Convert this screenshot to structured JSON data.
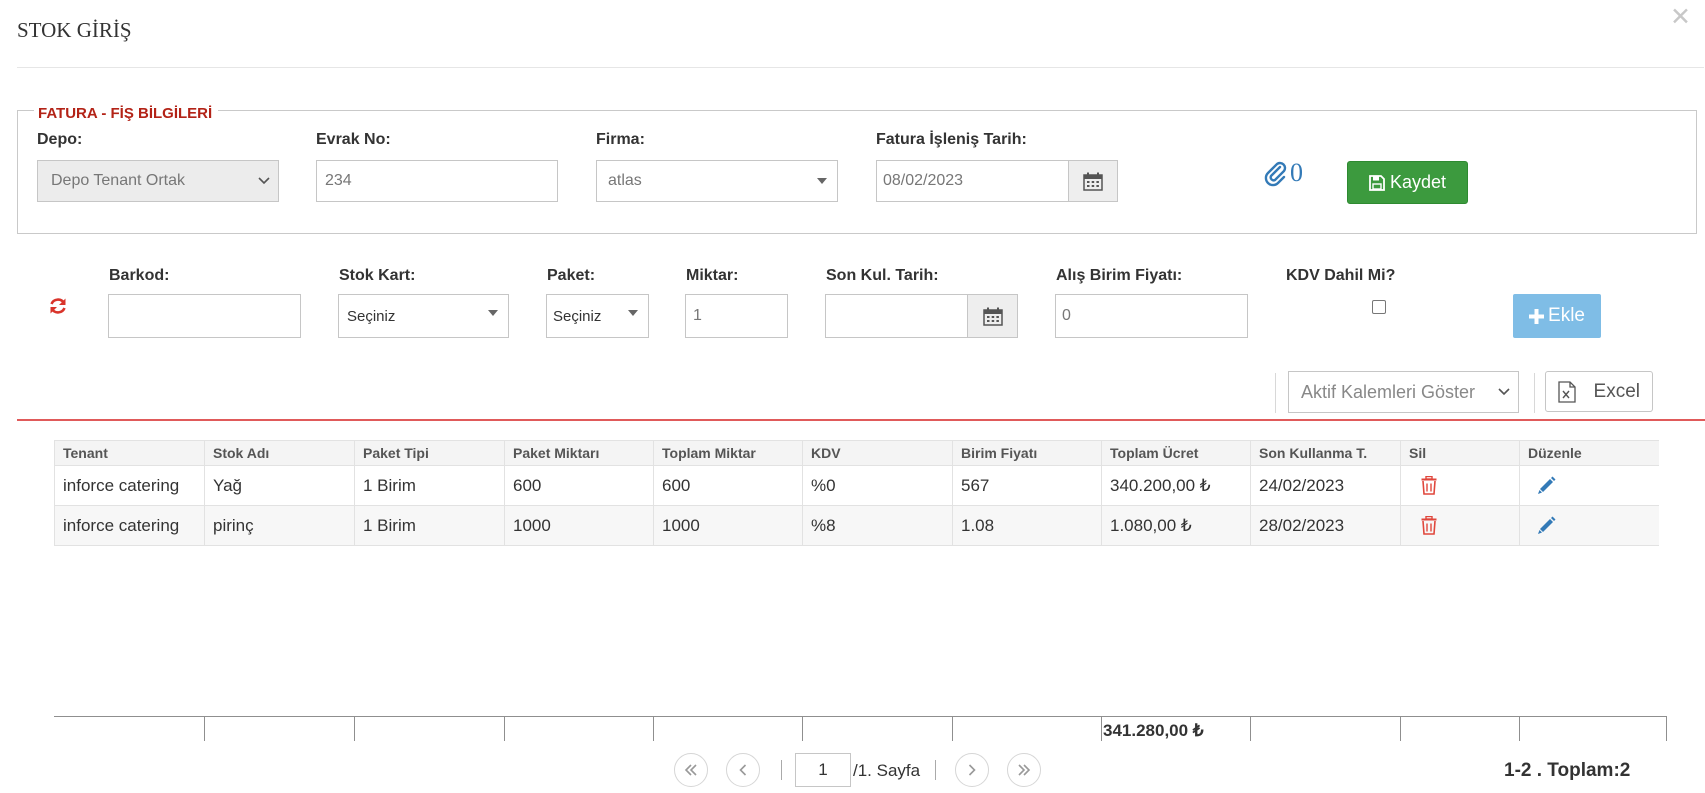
{
  "dialog": {
    "title": "STOK GİRİŞ"
  },
  "invoice": {
    "legend": "FATURA - FİŞ BİLGİLERİ",
    "depo_label": "Depo:",
    "depo_value": "Depo Tenant Ortak",
    "evrak_label": "Evrak No:",
    "evrak_value": "234",
    "firma_label": "Firma:",
    "firma_value": "atlas",
    "tarih_label": "Fatura İşleniş Tarih:",
    "tarih_value": "08/02/2023",
    "attachment_count": "0",
    "save_label": "Kaydet"
  },
  "entry": {
    "barkod_label": "Barkod:",
    "barkod_value": "",
    "stok_kart_label": "Stok Kart:",
    "stok_kart_value": "Seçiniz",
    "paket_label": "Paket:",
    "paket_value": "Seçiniz",
    "miktar_label": "Miktar:",
    "miktar_value": "1",
    "son_kul_label": "Son Kul. Tarih:",
    "son_kul_value": "",
    "fiyat_label": "Alış Birim Fiyatı:",
    "fiyat_value": "0",
    "kdv_label": "KDV Dahil Mi?",
    "add_label": "Ekle"
  },
  "toolbar": {
    "filter_value": "Aktif Kalemleri Göster",
    "excel_label": "Excel"
  },
  "grid": {
    "columns": [
      "Tenant",
      "Stok Adı",
      "Paket Tipi",
      "Paket Miktarı",
      "Toplam Miktar",
      "KDV",
      "Birim Fiyatı",
      "Toplam Ücret",
      "Son Kullanma T.",
      "Sil",
      "Düzenle"
    ],
    "rows": [
      [
        "inforce catering",
        "Yağ",
        "1 Birim",
        "600",
        "600",
        "%0",
        "567",
        "340.200,00 ₺",
        "24/02/2023"
      ],
      [
        "inforce catering",
        "pirinç",
        "1 Birim",
        "1000",
        "1000",
        "%8",
        "1.08",
        "1.080,00 ₺",
        "28/02/2023"
      ]
    ],
    "total": "341.280,00 ₺"
  },
  "pager": {
    "page": "1",
    "page_suffix": "/1. Sayfa",
    "records": "1-2 . Toplam:2"
  },
  "colors": {
    "legend": "#b32317",
    "save_button": "#3c9a3e",
    "add_button": "#7fbde6",
    "delete_icon": "#e0473c",
    "edit_icon": "#337ab7",
    "separator": "#e05a5a"
  }
}
